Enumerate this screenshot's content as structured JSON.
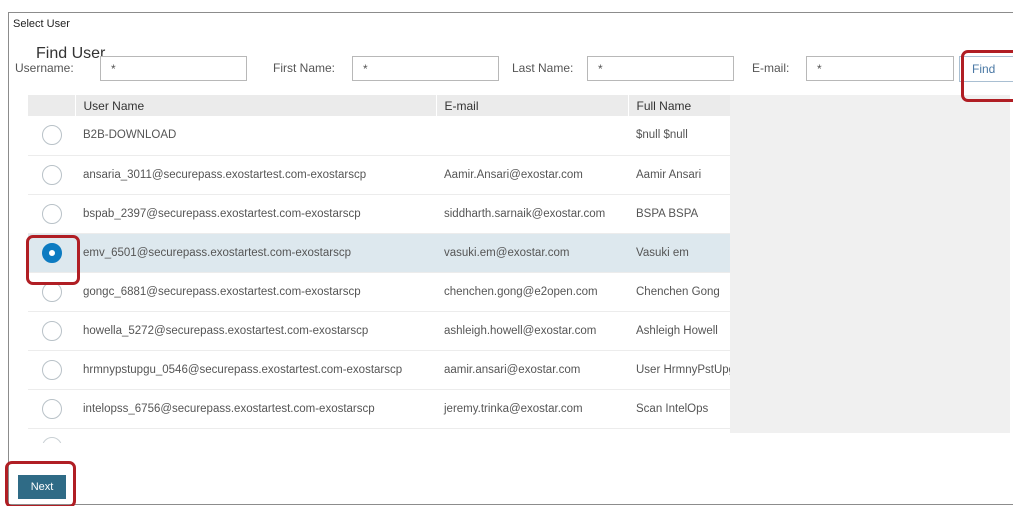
{
  "panel": {
    "title": "Select User",
    "heading": "Find User"
  },
  "search": {
    "username_label": "Username:",
    "username_value": "*",
    "firstname_label": "First Name:",
    "firstname_value": "*",
    "lastname_label": "Last Name:",
    "lastname_value": "*",
    "email_label": "E-mail:",
    "email_value": "*",
    "find_label": "Find"
  },
  "table": {
    "columns": [
      "",
      "User Name",
      "E-mail",
      "Full Name"
    ],
    "rows": [
      {
        "username": "B2B-DOWNLOAD",
        "email": "",
        "fullname": "$null $null",
        "selected": false
      },
      {
        "username": "ansaria_3011@securepass.exostartest.com-exostarscp",
        "email": "Aamir.Ansari@exostar.com",
        "fullname": "Aamir Ansari",
        "selected": false
      },
      {
        "username": "bspab_2397@securepass.exostartest.com-exostarscp",
        "email": "siddharth.sarnaik@exostar.com",
        "fullname": "BSPA BSPA",
        "selected": false
      },
      {
        "username": "emv_6501@securepass.exostartest.com-exostarscp",
        "email": "vasuki.em@exostar.com",
        "fullname": "Vasuki em",
        "selected": true
      },
      {
        "username": "gongc_6881@securepass.exostartest.com-exostarscp",
        "email": "chenchen.gong@e2open.com",
        "fullname": "Chenchen Gong",
        "selected": false
      },
      {
        "username": "howella_5272@securepass.exostartest.com-exostarscp",
        "email": "ashleigh.howell@exostar.com",
        "fullname": "Ashleigh Howell",
        "selected": false
      },
      {
        "username": "hrmnypstupgu_0546@securepass.exostartest.com-exostarscp",
        "email": "aamir.ansari@exostar.com",
        "fullname": "User HrmnyPstUpg",
        "selected": false
      },
      {
        "username": "intelopss_6756@securepass.exostartest.com-exostarscp",
        "email": "jeremy.trinka@exostar.com",
        "fullname": "Scan IntelOps",
        "selected": false
      }
    ]
  },
  "footer": {
    "next_label": "Next"
  },
  "colors": {
    "accent": "#0d7bc1",
    "selected_row": "#dde8ee",
    "next_button": "#2f6b86",
    "highlight": "#b01e24"
  }
}
